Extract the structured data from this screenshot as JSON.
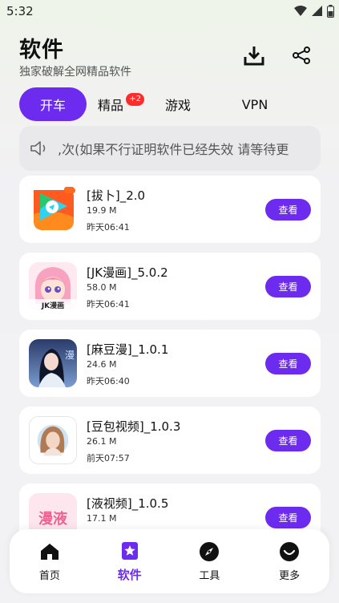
{
  "status": {
    "time": "5:32"
  },
  "header": {
    "title": "软件",
    "subtitle": "独家破解全网精品软件"
  },
  "tabs": [
    {
      "label": "开车"
    },
    {
      "label": "精品",
      "badge": "+2"
    },
    {
      "label": "游戏"
    },
    {
      "label": "VPN"
    }
  ],
  "notice": {
    "text": ",次(如果不行证明软件已经失效 请等待更"
  },
  "apps": [
    {
      "name": "[拔卜]_2.0",
      "size": "19.9 M",
      "time": "昨天06:41",
      "button": "查看"
    },
    {
      "name": "[JK漫画]_5.0.2",
      "size": "58.0 M",
      "time": "昨天06:41",
      "button": "查看"
    },
    {
      "name": "[麻豆漫]_1.0.1",
      "size": "24.6 M",
      "time": "昨天06:40",
      "button": "查看"
    },
    {
      "name": "[豆包视频]_1.0.3",
      "size": "26.1 M",
      "time": "前天07:57",
      "button": "查看"
    },
    {
      "name": "[液视频]_1.0.5",
      "size": "17.1 M",
      "time": "",
      "button": "查看"
    }
  ],
  "icon_text": {
    "jk": "JK漫画",
    "madou": "漫",
    "ye": "漫液"
  },
  "nav": [
    {
      "label": "首页",
      "icon": "home-icon"
    },
    {
      "label": "软件",
      "icon": "star-icon"
    },
    {
      "label": "工具",
      "icon": "compass-icon"
    },
    {
      "label": "更多",
      "icon": "smile-icon"
    }
  ],
  "colors": {
    "accent": "#6d2bf0",
    "badge": "#ff2a2a"
  }
}
